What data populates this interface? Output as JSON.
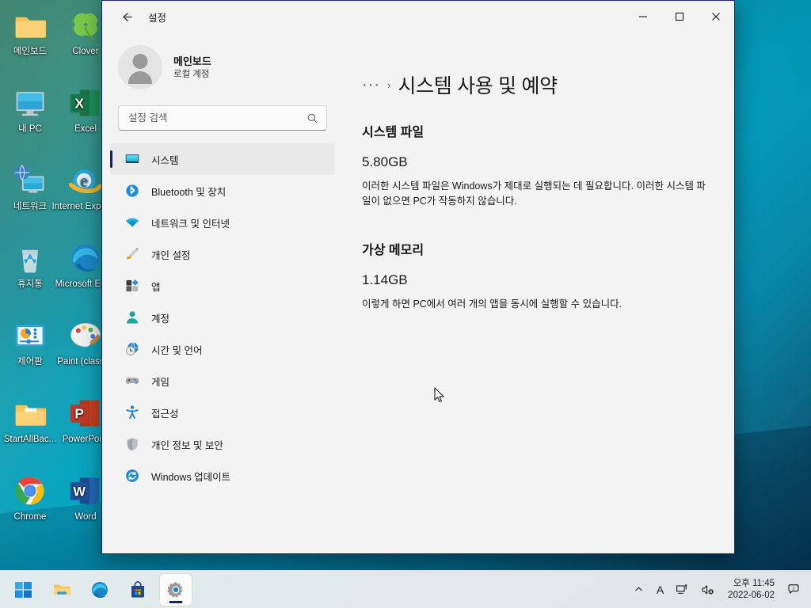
{
  "desktop": {
    "icons": [
      {
        "label": "메인보드",
        "icon": "folder-icon",
        "col": 0,
        "row": 0
      },
      {
        "label": "Clover",
        "icon": "clover-icon",
        "col": 1,
        "row": 0
      },
      {
        "label": "내 PC",
        "icon": "this-pc-icon",
        "col": 0,
        "row": 1
      },
      {
        "label": "Excel",
        "icon": "excel-icon",
        "col": 1,
        "row": 1
      },
      {
        "label": "네트워크",
        "icon": "network-icon",
        "col": 0,
        "row": 2
      },
      {
        "label": "Internet Explorer",
        "icon": "internet-explorer-icon",
        "col": 1,
        "row": 2
      },
      {
        "label": "휴지통",
        "icon": "recycle-bin-icon",
        "col": 0,
        "row": 3
      },
      {
        "label": "Microsoft Edge",
        "icon": "edge-icon",
        "col": 1,
        "row": 3
      },
      {
        "label": "제어판",
        "icon": "control-panel-icon",
        "col": 0,
        "row": 4
      },
      {
        "label": "Paint (classic)",
        "icon": "paint-icon",
        "col": 1,
        "row": 4
      },
      {
        "label": "StartAllBac...",
        "icon": "folder-doc-icon",
        "col": 0,
        "row": 5
      },
      {
        "label": "PowerPoint",
        "icon": "powerpoint-icon",
        "col": 1,
        "row": 5
      },
      {
        "label": "Chrome",
        "icon": "chrome-icon",
        "col": 0,
        "row": 6
      },
      {
        "label": "Word",
        "icon": "word-icon",
        "col": 1,
        "row": 6
      }
    ]
  },
  "window": {
    "title": "설정",
    "back_tooltip": "뒤로",
    "minimize_label": "—",
    "maximize_label": "☐",
    "close_label": "✕"
  },
  "sidebar": {
    "account": {
      "name": "메인보드",
      "type": "로컬 계정"
    },
    "search": {
      "placeholder": "설정 검색",
      "value": ""
    },
    "items": [
      {
        "label": "시스템",
        "icon": "system-monitor-icon",
        "active": true
      },
      {
        "label": "Bluetooth 및 장치",
        "icon": "bluetooth-icon",
        "active": false
      },
      {
        "label": "네트워크 및 인터넷",
        "icon": "wifi-icon",
        "active": false
      },
      {
        "label": "개인 설정",
        "icon": "paintbrush-icon",
        "active": false
      },
      {
        "label": "앱",
        "icon": "apps-icon",
        "active": false
      },
      {
        "label": "계정",
        "icon": "account-person-icon",
        "active": false
      },
      {
        "label": "시간 및 언어",
        "icon": "clock-globe-icon",
        "active": false
      },
      {
        "label": "게임",
        "icon": "gamepad-icon",
        "active": false
      },
      {
        "label": "접근성",
        "icon": "accessibility-person-icon",
        "active": false
      },
      {
        "label": "개인 정보 및 보안",
        "icon": "shield-icon",
        "active": false
      },
      {
        "label": "Windows 업데이트",
        "icon": "update-refresh-icon",
        "active": false
      }
    ]
  },
  "content": {
    "breadcrumb_dots": "···",
    "breadcrumb_separator": "›",
    "title": "시스템 사용 및 예약",
    "sections": [
      {
        "heading": "시스템 파일",
        "value": "5.80GB",
        "description": "이러한 시스템 파일은 Windows가 제대로 실행되는 데 필요합니다. 이러한 시스템 파일이 없으면 PC가 작동하지 않습니다."
      },
      {
        "heading": "가상 메모리",
        "value": "1.14GB",
        "description": "이렇게 하면 PC에서 여러 개의 앱을 동시에 실행할 수 있습니다."
      }
    ]
  },
  "taskbar": {
    "buttons": [
      {
        "name": "start-button",
        "icon": "windows-logo-icon",
        "active": false
      },
      {
        "name": "file-explorer-button",
        "icon": "folder-icon",
        "active": false
      },
      {
        "name": "edge-button",
        "icon": "edge-icon",
        "active": false
      },
      {
        "name": "microsoft-store-button",
        "icon": "store-bag-icon",
        "active": false
      },
      {
        "name": "settings-button",
        "icon": "gear-icon",
        "active": true
      }
    ],
    "tray": {
      "overflow_label": "⌃",
      "ime_label": "A",
      "network_icon": "network-tray-icon",
      "volume_icon": "speaker-muted-icon",
      "time": "오후 11:45",
      "date": "2022-06-02",
      "notification_icon": "notification-bell-dnd-icon"
    }
  },
  "colors": {
    "accent": "#15206b",
    "window_bg": "#f3f3f3",
    "selected_nav_bg": "#e9e9e9",
    "wallpaper_primary": "#06a6c4",
    "wallpaper_dark": "#083f5c",
    "close_hover": "#c42b1c"
  }
}
